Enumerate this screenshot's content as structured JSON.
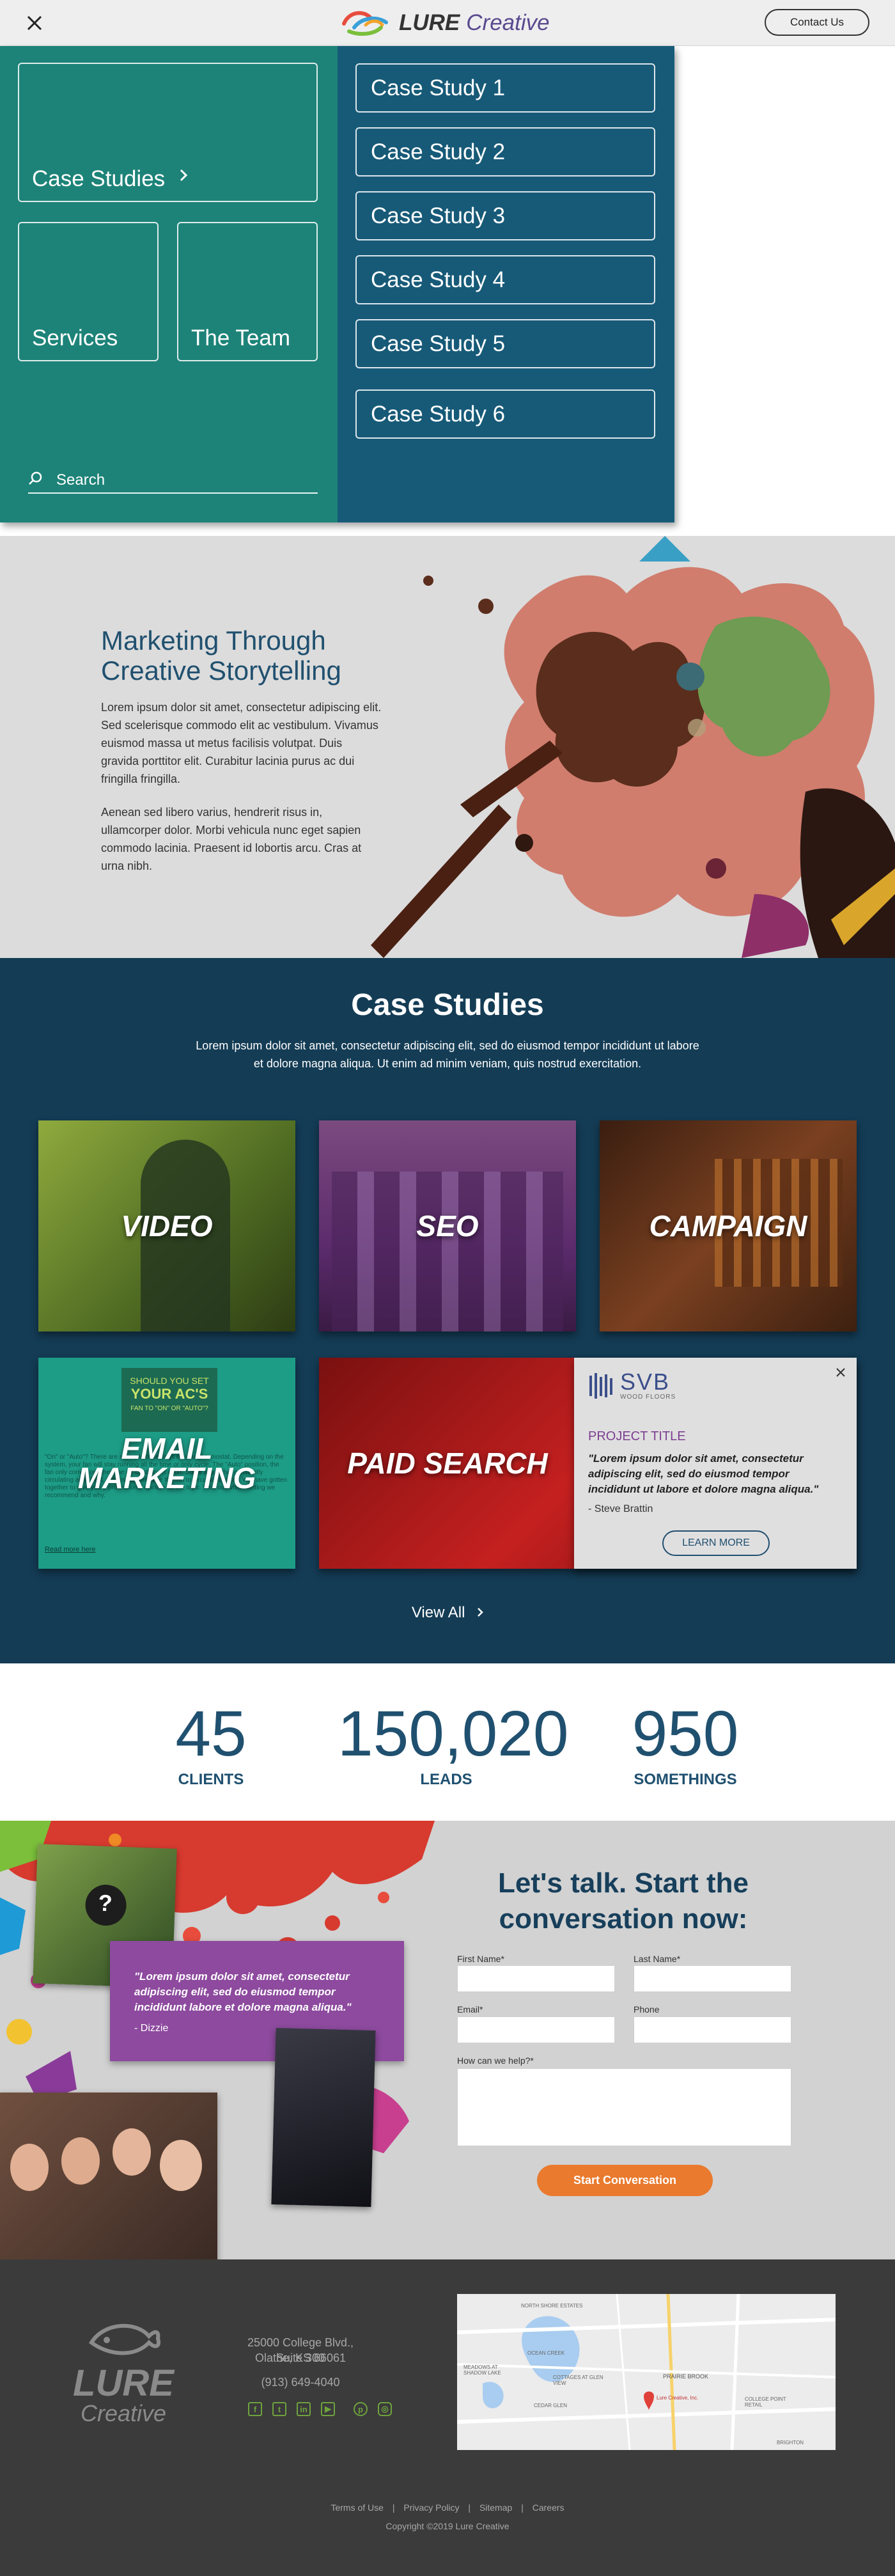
{
  "header": {
    "logo_word": "LURE",
    "logo_sub": "Creative",
    "contact_label": "Contact Us",
    "close_icon": "close-icon"
  },
  "menu": {
    "tiles": {
      "case_studies": "Case Studies",
      "services": "Services",
      "team": "The Team"
    },
    "case_studies": [
      "Case Study 1",
      "Case Study 2",
      "Case Study 3",
      "Case Study 4",
      "Case Study 5",
      "Case Study 6"
    ],
    "search_label": "Search",
    "colors": {
      "left": "#1d8378",
      "right": "#175a78"
    }
  },
  "hero": {
    "title": "Marketing Through Creative Storytelling",
    "para1": "Lorem ipsum dolor sit amet, consectetur adipiscing elit. Sed scelerisque commodo elit ac vestibulum. Vivamus euismod massa ut metus facilisis volutpat. Duis gravida porttitor elit. Curabitur lacinia purus ac dui fringilla fringilla.",
    "para2": "Aenean sed libero varius, hendrerit risus in, ullamcorper dolor. Morbi vehicula nunc eget sapien commodo lacinia. Praesent id lobortis arcu. Cras at urna nibh."
  },
  "case_studies": {
    "title": "Case Studies",
    "intro": "Lorem ipsum dolor sit amet, consectetur adipiscing elit, sed do eiusmod tempor incididunt ut labore et dolore magna aliqua. Ut enim ad minim veniam, quis nostrud exercitation.",
    "cards": {
      "video": "VIDEO",
      "seo": "SEO",
      "campaign": "CAMPAIGN",
      "email": "EMAIL MARKETING",
      "paid": "PAID SEARCH"
    },
    "email_bg": {
      "line1": "SHOULD YOU SET",
      "line2": "YOUR AC'S",
      "line3": "FAN TO \"ON\" OR \"AUTO\"?",
      "body": "\"On\" or \"Auto\"? There are a couple of settings on your thermostat. Depending on the system, your fan will stay running all the time or only cycle. The \"Auto\" position, the fan only comes on when the air conditioner is on. Some argue that constantly circulating air is best. Others say only use the fan to circulate cool air. We have gotten together to give you a professional opinion on the topic. Find out which setting we recommend and why.",
      "link": "Read more here"
    },
    "popup": {
      "logo": "SVB",
      "logo_sub": "WOOD FLOORS",
      "project_title": "PROJECT TITLE",
      "quote": "\"Lorem ipsum dolor sit amet, consectetur adipiscing elit, sed do eiusmod tempor incididunt ut labore et dolore magna aliqua.\"",
      "author": "- Steve Brattin",
      "learn_more": "LEARN MORE"
    },
    "view_all": "View All"
  },
  "stats": [
    {
      "value": "45",
      "label": "CLIENTS"
    },
    {
      "value": "150,020",
      "label": "LEADS"
    },
    {
      "value": "950",
      "label": "SOMETHINGS"
    }
  ],
  "talk": {
    "title": "Let's talk. Start the conversation now:",
    "testimonial": "\"Lorem ipsum dolor sit amet, consectetur adipiscing elit, sed do eiusmod tempor incididunt labore et dolore magna aliqua.\"",
    "testimonial_author": "- Dizzie",
    "labels": {
      "first": "First Name*",
      "last": "Last Name*",
      "email": "Email*",
      "phone": "Phone",
      "help": "How can we help?*"
    },
    "submit": "Start Conversation"
  },
  "footer": {
    "logo_word": "LURE",
    "logo_sub": "Creative",
    "address1": "25000 College Blvd., Suite 300",
    "address2": "Olathe, KS 66061",
    "phone": "(913) 649-4040",
    "social": [
      "facebook-icon",
      "twitter-icon",
      "linkedin-icon",
      "youtube-icon",
      "pinterest-icon",
      "instagram-icon"
    ],
    "map_labels": {
      "prairie": "PRAIRIE BROOK",
      "pin": "Lure Creative, Inc.",
      "cedar": "CEDAR GLEN",
      "cottages": "COTTAGES AT GLEN VIEW",
      "shadow": "MEADOWS AT SHADOW LAKE",
      "ocean": "OCEAN CREEK",
      "north": "NORTH SHORE ESTATES",
      "point": "COLLEGE POINT RETAIL",
      "brighton": "BRIGHTON"
    },
    "links": [
      "Terms of Use",
      "Privacy Policy",
      "Sitemap",
      "Careers"
    ],
    "copyright": "Copyright ©2019 Lure Creative"
  }
}
